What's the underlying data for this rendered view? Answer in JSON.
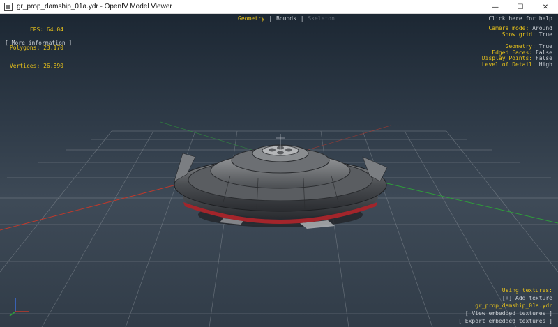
{
  "window": {
    "title": "gr_prop_damship_01a.ydr - OpenIV Model Viewer",
    "controls": {
      "minimize": "—",
      "maximize": "☐",
      "close": "✕"
    }
  },
  "stats": {
    "fps_label": "FPS:",
    "fps_value": "64.04",
    "polygons_label": "Polygons:",
    "polygons_value": "23,170",
    "vertices_label": "Vertices:",
    "vertices_value": "26,890"
  },
  "more_info": "[ More information ]",
  "tabs": {
    "geometry": "Geometry",
    "separator": "|",
    "bounds": "Bounds",
    "skeleton": "Skeleton"
  },
  "help": "Click here for help",
  "camera": {
    "camera_mode_label": "Camera mode:",
    "camera_mode_value": "Around",
    "show_grid_label": "Show grid:",
    "show_grid_value": "True"
  },
  "display": {
    "geometry_label": "Geometry:",
    "geometry_value": "True",
    "edged_faces_label": "Edged Faces:",
    "edged_faces_value": "False",
    "display_points_label": "Display Points:",
    "display_points_value": "False",
    "lod_label": "Level of Detail:",
    "lod_value": "High"
  },
  "textures": {
    "using_label": "Using textures:",
    "add": "[+] Add texture",
    "file": "gr_prop_damship_01a.ydr",
    "view_embedded": "[ View embedded textures ]",
    "export_embedded": "[ Export embedded textures ]"
  },
  "icons": {
    "app": "openiv-app-icon",
    "axis": "axis-gizmo-icon"
  },
  "colors": {
    "hud_yellow": "#e8c21a",
    "hud_gray": "#c9ced4",
    "axis_x": "#c0392b",
    "axis_y": "#2e9e3a",
    "axis_z": "#3c6fd6"
  }
}
